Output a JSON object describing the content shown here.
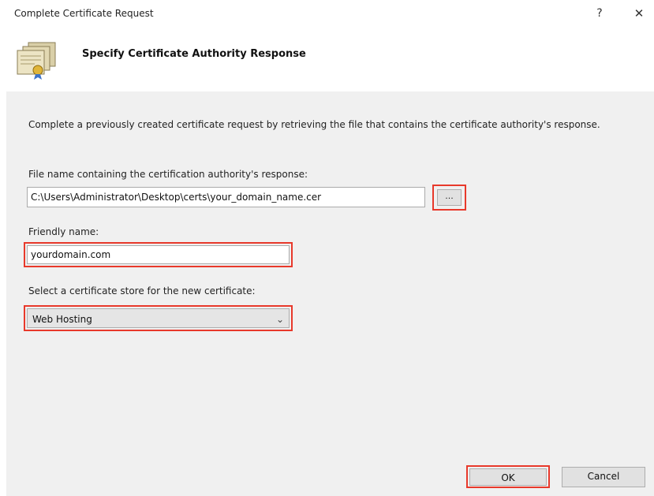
{
  "window": {
    "title": "Complete Certificate Request",
    "help_label": "?",
    "close_label": "✕"
  },
  "header": {
    "title": "Specify Certificate Authority Response",
    "icon": "certificate-icon"
  },
  "form": {
    "description": "Complete a previously created certificate request by retrieving the file that contains the certificate authority's response.",
    "file_label": "File name containing the certification authority's response:",
    "file_value": "C:\\Users\\Administrator\\Desktop\\certs\\your_domain_name.cer",
    "browse_label": "...",
    "friendly_label": "Friendly name:",
    "friendly_value": "yourdomain.com",
    "store_label": "Select a certificate store for the new certificate:",
    "store_value": "Web Hosting",
    "store_chevron": "⌄"
  },
  "buttons": {
    "ok_label": "OK",
    "cancel_label": "Cancel"
  },
  "colors": {
    "highlight": "#e8392b",
    "content_bg": "#f0f0f0"
  }
}
